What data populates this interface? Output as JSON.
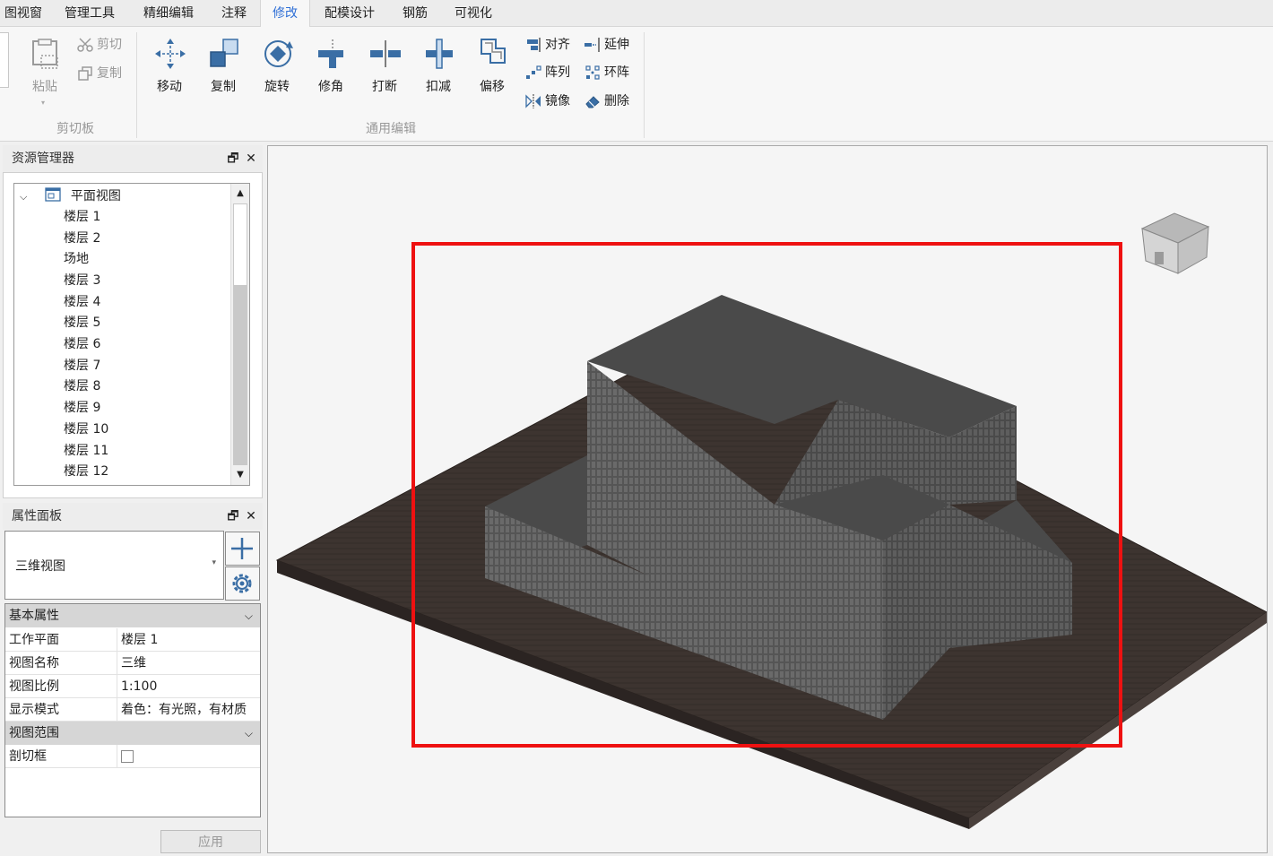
{
  "menu": {
    "tabs": [
      {
        "label": "图视窗"
      },
      {
        "label": "管理工具"
      },
      {
        "label": "精细编辑"
      },
      {
        "label": "注释"
      },
      {
        "label": "修改"
      },
      {
        "label": "配模设计"
      },
      {
        "label": "钢筋"
      },
      {
        "label": "可视化"
      }
    ],
    "active": "修改"
  },
  "ribbon": {
    "clipboard": {
      "group_label": "剪切板",
      "paste": "粘贴",
      "cut": "剪切",
      "copy": "复制"
    },
    "general_edit": {
      "group_label": "通用编辑",
      "move": "移动",
      "copy": "复制",
      "rotate": "旋转",
      "trim": "修角",
      "break": "打断",
      "subtract": "扣减",
      "offset": "偏移",
      "align": "对齐",
      "extend": "延伸",
      "array": "阵列",
      "ring_array": "环阵",
      "mirror": "镜像",
      "delete": "删除"
    }
  },
  "resource_manager": {
    "title": "资源管理器",
    "root": "平面视图",
    "items": [
      "楼层 1",
      "楼层 2",
      "场地",
      "楼层 3",
      "楼层 4",
      "楼层 5",
      "楼层 6",
      "楼层 7",
      "楼层 8",
      "楼层 9",
      "楼层 10",
      "楼层 11",
      "楼层 12"
    ]
  },
  "properties": {
    "title": "属性面板",
    "view_type": "三维视图",
    "section_basic": "基本属性",
    "rows": [
      {
        "key": "工作平面",
        "value": "楼层 1"
      },
      {
        "key": "视图名称",
        "value": "三维"
      },
      {
        "key": "视图比例",
        "value": "1:100"
      },
      {
        "key": "显示模式",
        "value": "着色：有光照，有材质"
      }
    ],
    "section_range": "视图范围",
    "section_box": "剖切框",
    "apply": "应用"
  },
  "colors": {
    "accent": "#2f6fd6",
    "highlight_box": "#ee1111",
    "ground": "#3d3430",
    "building_top": "#4a4a4a"
  }
}
